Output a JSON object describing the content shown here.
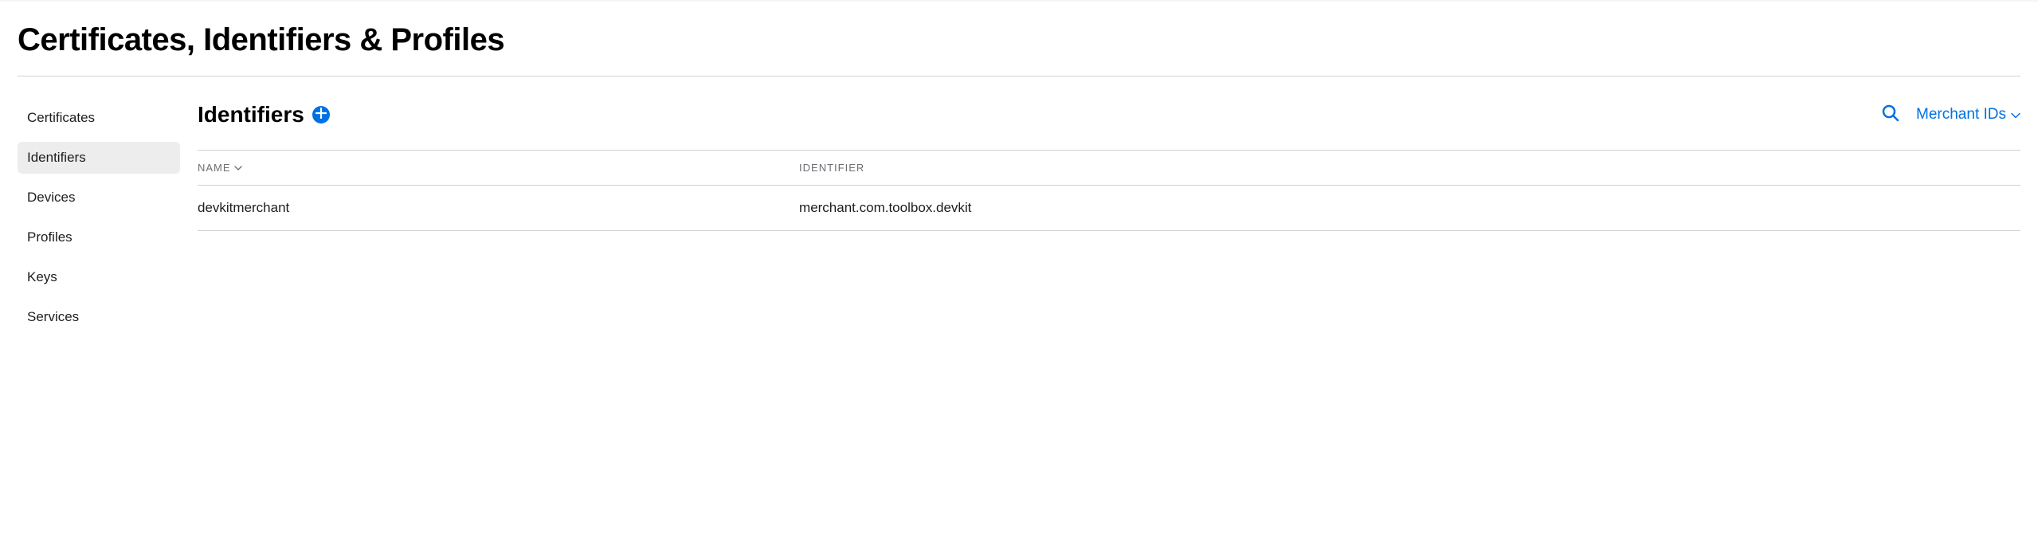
{
  "page": {
    "title": "Certificates, Identifiers & Profiles"
  },
  "sidebar": {
    "items": [
      {
        "label": "Certificates",
        "active": false
      },
      {
        "label": "Identifiers",
        "active": true
      },
      {
        "label": "Devices",
        "active": false
      },
      {
        "label": "Profiles",
        "active": false
      },
      {
        "label": "Keys",
        "active": false
      },
      {
        "label": "Services",
        "active": false
      }
    ]
  },
  "section": {
    "title": "Identifiers",
    "filter_label": "Merchant IDs"
  },
  "table": {
    "columns": {
      "name": "NAME",
      "identifier": "IDENTIFIER"
    },
    "rows": [
      {
        "name": "devkitmerchant",
        "identifier": "merchant.com.toolbox.devkit"
      }
    ]
  },
  "colors": {
    "accent": "#0071e3"
  }
}
